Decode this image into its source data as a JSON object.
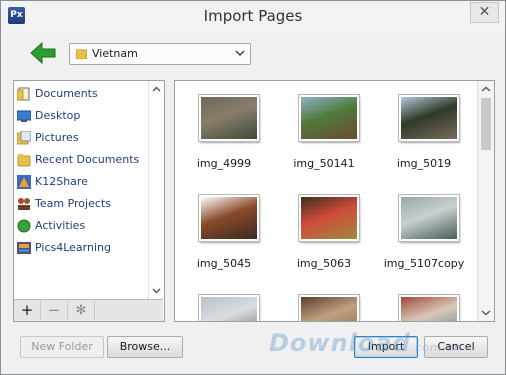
{
  "window": {
    "title": "Import Pages",
    "app_icon_text": "Px",
    "close_symbol": "✕"
  },
  "toolbar": {
    "back_icon": "back-arrow-icon",
    "path_value": "Vietnam"
  },
  "sidebar": {
    "items": [
      {
        "label": "Documents",
        "icon": "documents-icon"
      },
      {
        "label": "Desktop",
        "icon": "desktop-icon"
      },
      {
        "label": "Pictures",
        "icon": "pictures-icon"
      },
      {
        "label": "Recent Documents",
        "icon": "folder-icon"
      },
      {
        "label": "K12Share",
        "icon": "k12share-icon"
      },
      {
        "label": "Team Projects",
        "icon": "team-icon"
      },
      {
        "label": "Activities",
        "icon": "activities-icon"
      },
      {
        "label": "Pics4Learning",
        "icon": "pics4learning-icon"
      }
    ],
    "add_symbol": "+",
    "remove_symbol": "−",
    "settings_symbol": "✻"
  },
  "grid": {
    "items": [
      {
        "name": "img_4999",
        "colors": [
          "#6b6b5a",
          "#3e4a3a",
          "#8a7c6a"
        ]
      },
      {
        "name": "img_50141",
        "colors": [
          "#8fb0c8",
          "#6b4a32",
          "#4f7a3a"
        ]
      },
      {
        "name": "img_5019",
        "colors": [
          "#b8c8d8",
          "#7a6a5a",
          "#2e3a2a"
        ]
      },
      {
        "name": "img_5045",
        "colors": [
          "#ffffff",
          "#3a2a20",
          "#8a4a2a"
        ]
      },
      {
        "name": "img_5063",
        "colors": [
          "#3a3020",
          "#a08a40",
          "#d04a3a"
        ]
      },
      {
        "name": "img_5107copy",
        "colors": [
          "#9aa8a8",
          "#4a5a5a",
          "#c8d0d0"
        ]
      },
      {
        "name": "",
        "colors": [
          "#b8c0c8",
          "#6a7478",
          "#d8dde0"
        ]
      },
      {
        "name": "",
        "colors": [
          "#5a4030",
          "#8a6848",
          "#c0a080"
        ]
      },
      {
        "name": "",
        "colors": [
          "#a04a3a",
          "#6a7a8a",
          "#d8c8b8"
        ]
      }
    ]
  },
  "footer": {
    "new_folder_label": "New Folder",
    "browse_label": "Browse...",
    "import_label": "Import",
    "cancel_label": "Cancel"
  },
  "watermark": {
    "text": "Download",
    "suffix": ".com.vn"
  }
}
